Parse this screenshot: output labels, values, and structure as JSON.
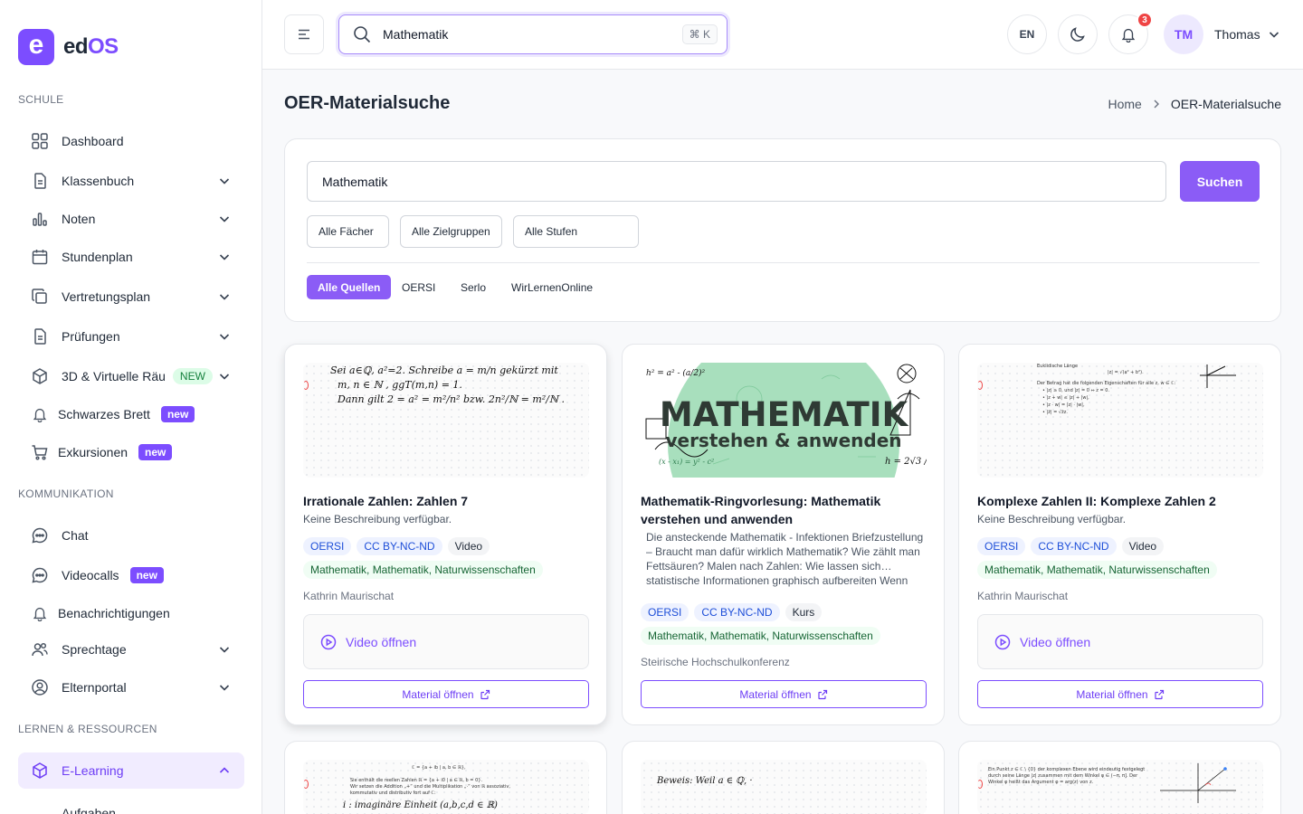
{
  "app": {
    "logo_letter": "e",
    "logo_ed": "ed",
    "logo_os": "OS"
  },
  "sidebar": {
    "sections": {
      "schule": "SCHULE",
      "kommunikation": "KOMMUNIKATION",
      "lernen": "LERNEN & RESSOURCEN"
    },
    "items": {
      "dashboard": "Dashboard",
      "klassenbuch": "Klassenbuch",
      "noten": "Noten",
      "stundenplan": "Stundenplan",
      "vertretungsplan": "Vertretungsplan",
      "pruefungen": "Prüfungen",
      "virtuell": "3D & Virtuelle Räu",
      "virtuell_badge": "NEW",
      "brett": "Schwarzes Brett",
      "brett_badge": "new",
      "exkursionen": "Exkursionen",
      "exkursionen_badge": "new",
      "chat": "Chat",
      "videocalls": "Videocalls",
      "videocalls_badge": "new",
      "benachrichtigungen": "Benachrichtigungen",
      "sprechtage": "Sprechtage",
      "elternportal": "Elternportal",
      "elearning": "E-Learning",
      "aufgaben": "Aufgaben"
    }
  },
  "topbar": {
    "search_value": "Mathematik",
    "search_shortcut": "⌘ K",
    "lang": "EN",
    "notif_count": "3",
    "avatar_initials": "TM",
    "user_name": "Thomas"
  },
  "page": {
    "title": "OER-Materialsuche",
    "breadcrumb_home": "Home",
    "breadcrumb_current": "OER-Materialsuche"
  },
  "search": {
    "value": "Mathematik",
    "button": "Suchen",
    "filters": [
      "Alle Fächer",
      "Alle Zielgruppen",
      "Alle Stufen"
    ],
    "sources": [
      "Alle Quellen",
      "OERSI",
      "Serlo",
      "WirLernenOnline"
    ]
  },
  "cards": [
    {
      "title": "Irrationale Zahlen: Zahlen 7",
      "description": "Keine Beschreibung verfügbar.",
      "tags": [
        "OERSI",
        "CC BY-NC-ND",
        "Video"
      ],
      "subjects": "Mathematik, Mathematik, Naturwissenschaften",
      "author": "Kathrin Maurischat",
      "video_label": "Video öffnen",
      "material_label": "Material öffnen",
      "thumb_lines": [
        "Sei a∈ℚ, a²=2. Schreibe a = m/n  gekürzt mit",
        "m, n ∈ ℕ ,  ggT(m,n) = 1.",
        "Dann gilt  2 = a² = m²/n²   bzw.  2n²/ℕ = m²/ℕ ."
      ]
    },
    {
      "title": "Mathematik-Ringvorlesung: Mathematik verstehen und anwenden",
      "description": "Die ansteckende Mathematik - Infektionen Briefzustellung – Braucht man dafür wirklich Mathematik? Wie zählt man Fettsäuren? Malen nach Zahlen: Wie lassen sich… statistische Informationen graphisch aufbereiten Wenn Mathematik Hochstapler entlarvt Rudern mit…",
      "tags": [
        "OERSI",
        "CC BY-NC-ND",
        "Kurs"
      ],
      "subjects": "Mathematik, Mathematik, Naturwissenschaften",
      "author": "Steirische Hochschulkonferenz",
      "material_label": "Material öffnen",
      "thumb_big": "MATHEMATIK",
      "thumb_sub": "verstehen & anwenden"
    },
    {
      "title": "Komplexe Zahlen II: Komplexe Zahlen 2",
      "description": "Keine Beschreibung verfügbar.",
      "tags": [
        "OERSI",
        "CC BY-NC-ND",
        "Video"
      ],
      "subjects": "Mathematik, Mathematik, Naturwissenschaften",
      "author": "Kathrin Maurischat",
      "video_label": "Video öffnen",
      "material_label": "Material öffnen",
      "thumb_lines": [
        "Euklidische Länge",
        "|z| = √(a² + b²).",
        "Der Betrag hat die folgenden Eigenschaften für alle z, w ∈ ℂ:",
        "• |z| ≥ 0, und |z| = 0 ⇔ z = 0.",
        "• |z + w| ≤ |z| + |w|,",
        "• |z · w| = |z| · |w|,",
        "• |z̄| = √z̄z."
      ]
    },
    {
      "thumb_lines": [
        "ℂ = {a + ib | a, b ∈ ℝ},",
        "Sie enthält die reellen Zahlen ℝ = {a + i0 | a ∈ ℝ, b = 0}.",
        "Wir setzen die Addition „+“ und die Multiplikation „·“ von ℝ assoziativ,",
        "kommutativ und distributiv fort auf ℂ:",
        "i : imaginäre Einheit          (a,b,c,d ∈ ℝ)"
      ]
    },
    {
      "thumb_lines": [
        "Beweis:   Weil a ∈ ℚ,   ·"
      ]
    },
    {
      "thumb_lines": [
        "Ein Punkt z ∈ ℂ \\ {0} der komplexen Ebene wird eindeutig festgelegt",
        "durch seine Länge |z| zusammen mit dem Winkel φ ∈ (−π, π]. Der",
        "Winkel φ heißt das Argument φ = arg(z) von z."
      ]
    }
  ]
}
